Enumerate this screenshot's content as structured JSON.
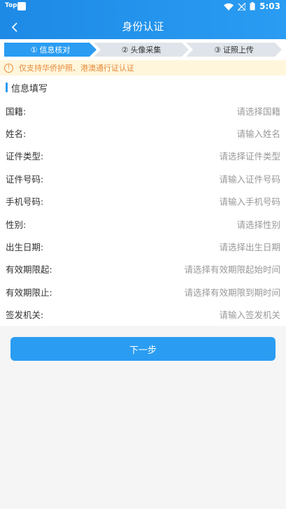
{
  "status_bar": {
    "app_label": "Top",
    "time": "5:03"
  },
  "header": {
    "title": "身份认证"
  },
  "steps": [
    {
      "num": "①",
      "label": "信息核对",
      "active": true
    },
    {
      "num": "②",
      "label": "头像采集",
      "active": false
    },
    {
      "num": "③",
      "label": "证照上传",
      "active": false
    }
  ],
  "notice": {
    "icon_text": "!",
    "text": "仅支持华侨护照、港澳通行证认证"
  },
  "form": {
    "section_title": "信息填写",
    "rows": [
      {
        "label": "国籍:",
        "placeholder": "请选择国籍"
      },
      {
        "label": "姓名:",
        "placeholder": "请输入姓名"
      },
      {
        "label": "证件类型:",
        "placeholder": "请选择证件类型"
      },
      {
        "label": "证件号码:",
        "placeholder": "请输入证件号码"
      },
      {
        "label": "手机号码:",
        "placeholder": "请输入手机号码"
      },
      {
        "label": "性别:",
        "placeholder": "请选择性别"
      },
      {
        "label": "出生日期:",
        "placeholder": "请选择出生日期"
      },
      {
        "label": "有效期限起:",
        "placeholder": "请选择有效期限起始时间"
      },
      {
        "label": "有效期限止:",
        "placeholder": "请选择有效期限到期时间"
      },
      {
        "label": "签发机关:",
        "placeholder": "请输入签发机关"
      }
    ]
  },
  "next_button": {
    "label": "下一步"
  },
  "colors": {
    "primary": "#2a9cf2",
    "notice_text": "#e68a3a",
    "notice_bg": "#fff6dc"
  }
}
